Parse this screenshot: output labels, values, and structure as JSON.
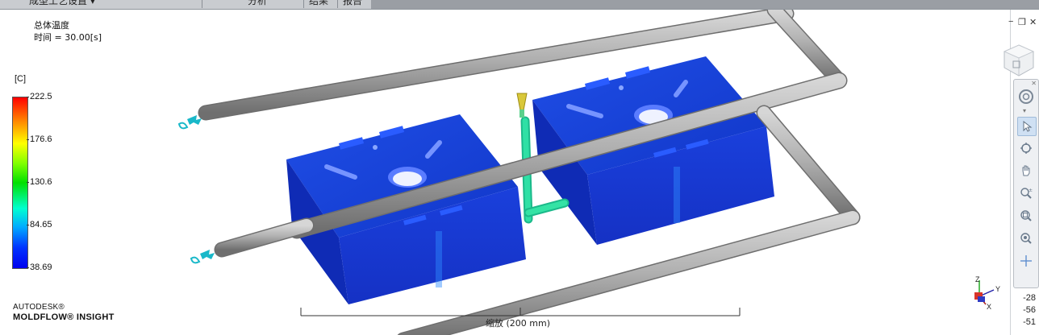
{
  "tabs": [
    {
      "label": "成型工艺设置 ▾"
    },
    {
      "label": "分析"
    },
    {
      "label": "结果"
    },
    {
      "label": "报告"
    }
  ],
  "result": {
    "title": "总体温度",
    "time_line": "时间 = 30.00[s]"
  },
  "legend": {
    "unit": "[C]",
    "ticks": [
      "222.5",
      "176.6",
      "130.6",
      "84.65",
      "38.69"
    ]
  },
  "brand": {
    "line1": "AUTODESK®",
    "line2": "MOLDFLOW® INSIGHT"
  },
  "scale_bar": {
    "label": "缩放 (200 mm)"
  },
  "axes_triad": {
    "z": "Z",
    "y": "Y",
    "x": "X"
  },
  "coords": [
    "-28",
    "-56",
    "-51"
  ],
  "window_controls": {
    "minimize": "−",
    "restore": "❐",
    "close": "✕"
  },
  "colors": {
    "part_blue": "#1436d8",
    "pipe_gray": "#a8a8a8",
    "runner_green": "#1fd39a",
    "inlet_cyan": "#19b8c9"
  },
  "nav_tools": [
    {
      "icon": "steering-wheel-icon"
    },
    {
      "icon": "select-arrow-icon"
    },
    {
      "icon": "rotate-icon"
    },
    {
      "icon": "pan-hand-icon"
    },
    {
      "icon": "zoom-icon"
    },
    {
      "icon": "zoom-window-icon"
    },
    {
      "icon": "zoom-fit-icon"
    },
    {
      "icon": "center-icon"
    }
  ]
}
